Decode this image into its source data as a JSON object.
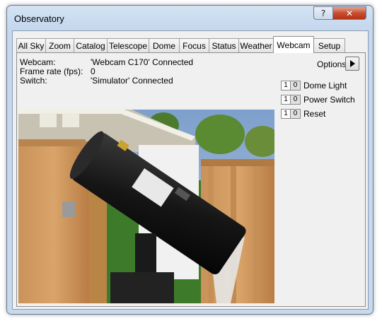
{
  "window": {
    "title": "Observatory"
  },
  "caption_buttons": {
    "help": "?",
    "close": "✕"
  },
  "tabs": [
    {
      "label": "All Sky"
    },
    {
      "label": "Zoom"
    },
    {
      "label": "Catalog"
    },
    {
      "label": "Telescope"
    },
    {
      "label": "Dome"
    },
    {
      "label": "Focus"
    },
    {
      "label": "Status"
    },
    {
      "label": "Weather"
    },
    {
      "label": "Webcam",
      "active": true
    },
    {
      "label": "Setup"
    }
  ],
  "info": [
    {
      "label": "Webcam:",
      "value": "'Webcam C170' Connected"
    },
    {
      "label": "Frame rate (fps):",
      "value": "0"
    },
    {
      "label": "Switch:",
      "value": "'Simulator' Connected"
    }
  ],
  "options": {
    "label": "Options",
    "icon": "play-right-icon"
  },
  "switches": [
    {
      "on": "1",
      "off": "0",
      "label": "Dome Light"
    },
    {
      "on": "1",
      "off": "0",
      "label": "Power Switch"
    },
    {
      "on": "1",
      "off": "0",
      "label": "Reset"
    }
  ],
  "webcam_image": {
    "subject": "telescope-photo"
  }
}
